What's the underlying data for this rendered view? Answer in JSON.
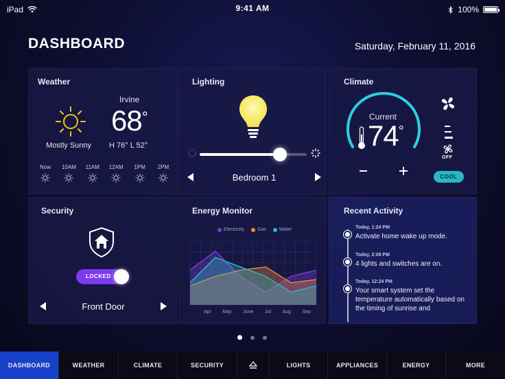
{
  "status": {
    "device": "iPad",
    "time": "9:41 AM",
    "battery": "100%"
  },
  "header": {
    "title": "DASHBOARD",
    "date": "Saturday, February 11, 2016"
  },
  "weather": {
    "title": "Weather",
    "city": "Irvine",
    "temp": "68",
    "degree": "°",
    "condition": "Mostly Sunny",
    "hilo": "H 76°  L 52°",
    "hours": [
      "Now",
      "10AM",
      "11AM",
      "12AM",
      "1PM",
      "2PM"
    ]
  },
  "lighting": {
    "title": "Lighting",
    "brightness": 0.75,
    "room": "Bedroom 1"
  },
  "climate": {
    "title": "Climate",
    "label": "Current",
    "temp": "74",
    "degree": "°",
    "fan": "OFF",
    "mode": "COOL",
    "accent": "#27b8c6"
  },
  "security": {
    "title": "Security",
    "state": "LOCKED",
    "door": "Front Door",
    "accent": "#7c3aed"
  },
  "energy": {
    "title": "Energy Monitor",
    "legend": [
      {
        "name": "Electricity",
        "color": "#7b3fd6"
      },
      {
        "name": "Gas",
        "color": "#f08a3c"
      },
      {
        "name": "Water",
        "color": "#2fb6c4"
      }
    ],
    "months": [
      "Apr",
      "May",
      "June",
      "Jul",
      "Aug",
      "Sep"
    ]
  },
  "chart_data": {
    "type": "area",
    "categories": [
      "Apr",
      "May",
      "June",
      "Jul",
      "Aug",
      "Sep"
    ],
    "series": [
      {
        "name": "Electricity",
        "values": [
          55,
          85,
          45,
          20,
          45,
          55
        ]
      },
      {
        "name": "Gas",
        "values": [
          30,
          45,
          55,
          60,
          35,
          40
        ]
      },
      {
        "name": "Water",
        "values": [
          35,
          75,
          60,
          45,
          20,
          30
        ]
      }
    ],
    "ylim": [
      0,
      100
    ],
    "grid": true
  },
  "activity": {
    "title": "Recent Activity",
    "items": [
      {
        "time": "Today, 1:24 PM",
        "text": "Activate home wake up mode."
      },
      {
        "time": "Today, 2:08 PM",
        "text": "4 lights and switches are on."
      },
      {
        "time": "Today, 12:24 PM",
        "text": "Your smart system set the temperature automatically based on the timing of sunrise and"
      }
    ]
  },
  "pager": {
    "pages": 3,
    "current": 1
  },
  "nav": {
    "items": [
      "DASHBOARD",
      "WEATHER",
      "CLIMATE",
      "SECURITY",
      "LIGHTS",
      "APPLIANCES",
      "ENERGY",
      "MORE"
    ],
    "active": "DASHBOARD",
    "active_color": "#1741c8"
  }
}
